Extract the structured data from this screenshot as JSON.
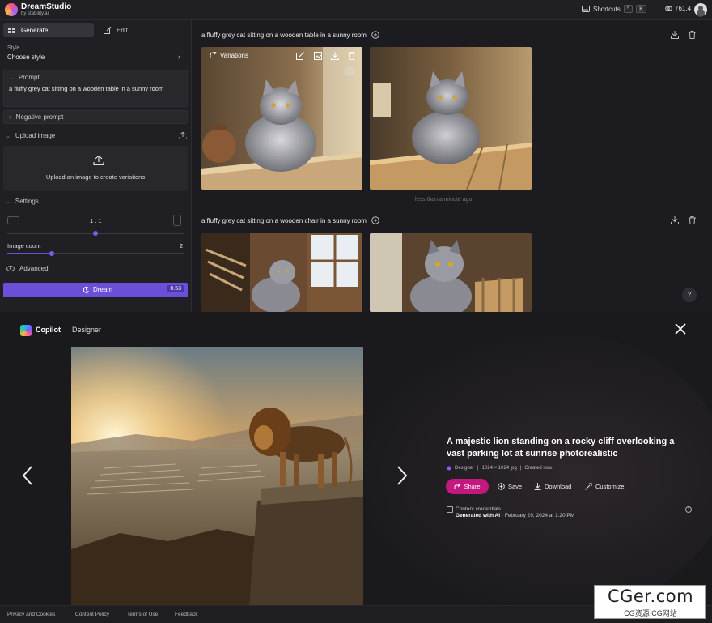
{
  "dreamstudio": {
    "brand": "DreamStudio",
    "brand_sub": "by stability.ai",
    "shortcuts_label": "Shortcuts",
    "shortcut_keys": [
      "^",
      "K"
    ],
    "credits": "761.4",
    "tabs": {
      "generate": "Generate",
      "edit": "Edit"
    },
    "style": {
      "label": "Style",
      "value": "Choose style"
    },
    "prompt": {
      "label": "Prompt",
      "value": "a fluffy grey cat sitting on a wooden table in a sunny room"
    },
    "negative_prompt_label": "Negative prompt",
    "upload": {
      "label": "Upload image",
      "text": "Upload an image to create variations"
    },
    "settings": {
      "label": "Settings",
      "aspect_ratio": "1 : 1",
      "image_count_label": "Image count",
      "image_count": "2",
      "image_count_fraction": 0.25
    },
    "advanced_label": "Advanced",
    "dream": {
      "label": "Dream",
      "cost": "0.53"
    },
    "generations": [
      {
        "prompt": "a fluffy grey cat sitting on a wooden table in a sunny room",
        "time": "less than a minute ago",
        "variations_label": "Variations"
      },
      {
        "prompt": "a fluffy grey cat sitting on a wooden chair in a sunny room"
      }
    ],
    "help": "?"
  },
  "copilot": {
    "brand": "Copilot",
    "product": "Designer",
    "image_title": "A majestic lion standing on a rocky cliff overlooking a vast parking lot at sunrise photorealistic",
    "meta": {
      "source": "Designer",
      "size": "1024 × 1024 jpg",
      "created": "Created now"
    },
    "actions": {
      "share": "Share",
      "save": "Save",
      "download": "Download",
      "customize": "Customize"
    },
    "credentials": {
      "title": "Content credentials",
      "generated": "Generated with AI",
      "date": "· February 29, 2024 at 1:20 PM"
    },
    "footer": [
      "Privacy and Cookies",
      "Content Policy",
      "Terms of Use",
      "Feedback"
    ]
  },
  "watermark": {
    "top": "CGer.com",
    "bottom": "CG资源 CG网站"
  },
  "colors": {
    "accent_purple": "#6b4fd9",
    "share_pink": "#c2187f"
  }
}
